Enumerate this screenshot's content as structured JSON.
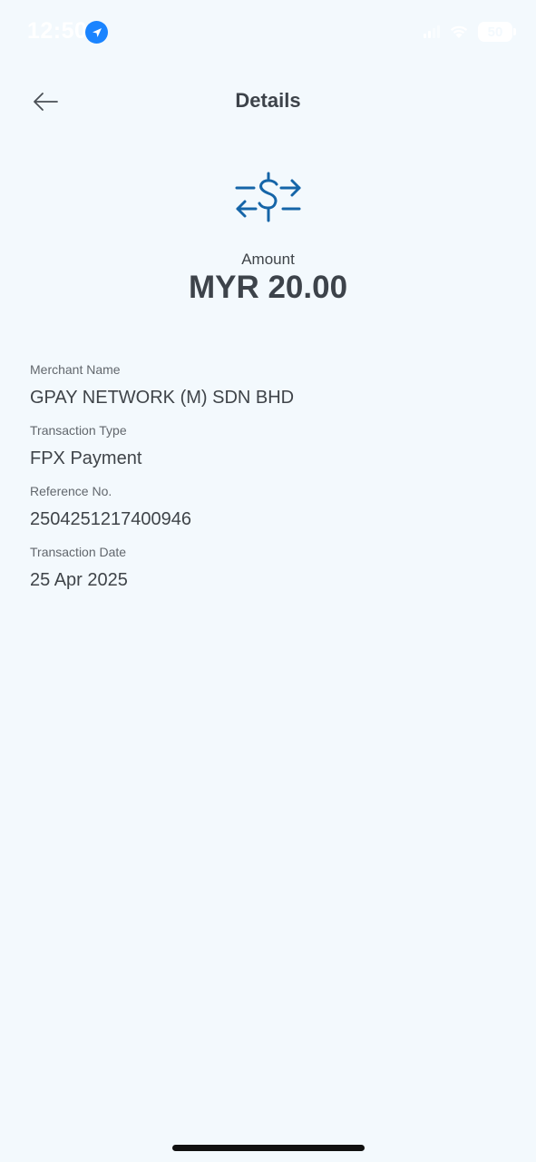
{
  "status_bar": {
    "time": "12:50",
    "battery": "50"
  },
  "header": {
    "title": "Details"
  },
  "icons": {
    "back": "arrow-left-icon",
    "transfer": "currency-transfer-icon",
    "location": "location-arrow-icon"
  },
  "amount": {
    "label": "Amount",
    "value": "MYR 20.00"
  },
  "details": [
    {
      "label": "Merchant Name",
      "value": "GPAY NETWORK (M) SDN BHD"
    },
    {
      "label": "Transaction Type",
      "value": "FPX Payment"
    },
    {
      "label": "Reference No.",
      "value": "2504251217400946"
    },
    {
      "label": "Transaction Date",
      "value": "25 Apr 2025"
    }
  ],
  "colors": {
    "background": "#f3f9fd",
    "accent": "#1565a8",
    "text": "#3f4449"
  }
}
